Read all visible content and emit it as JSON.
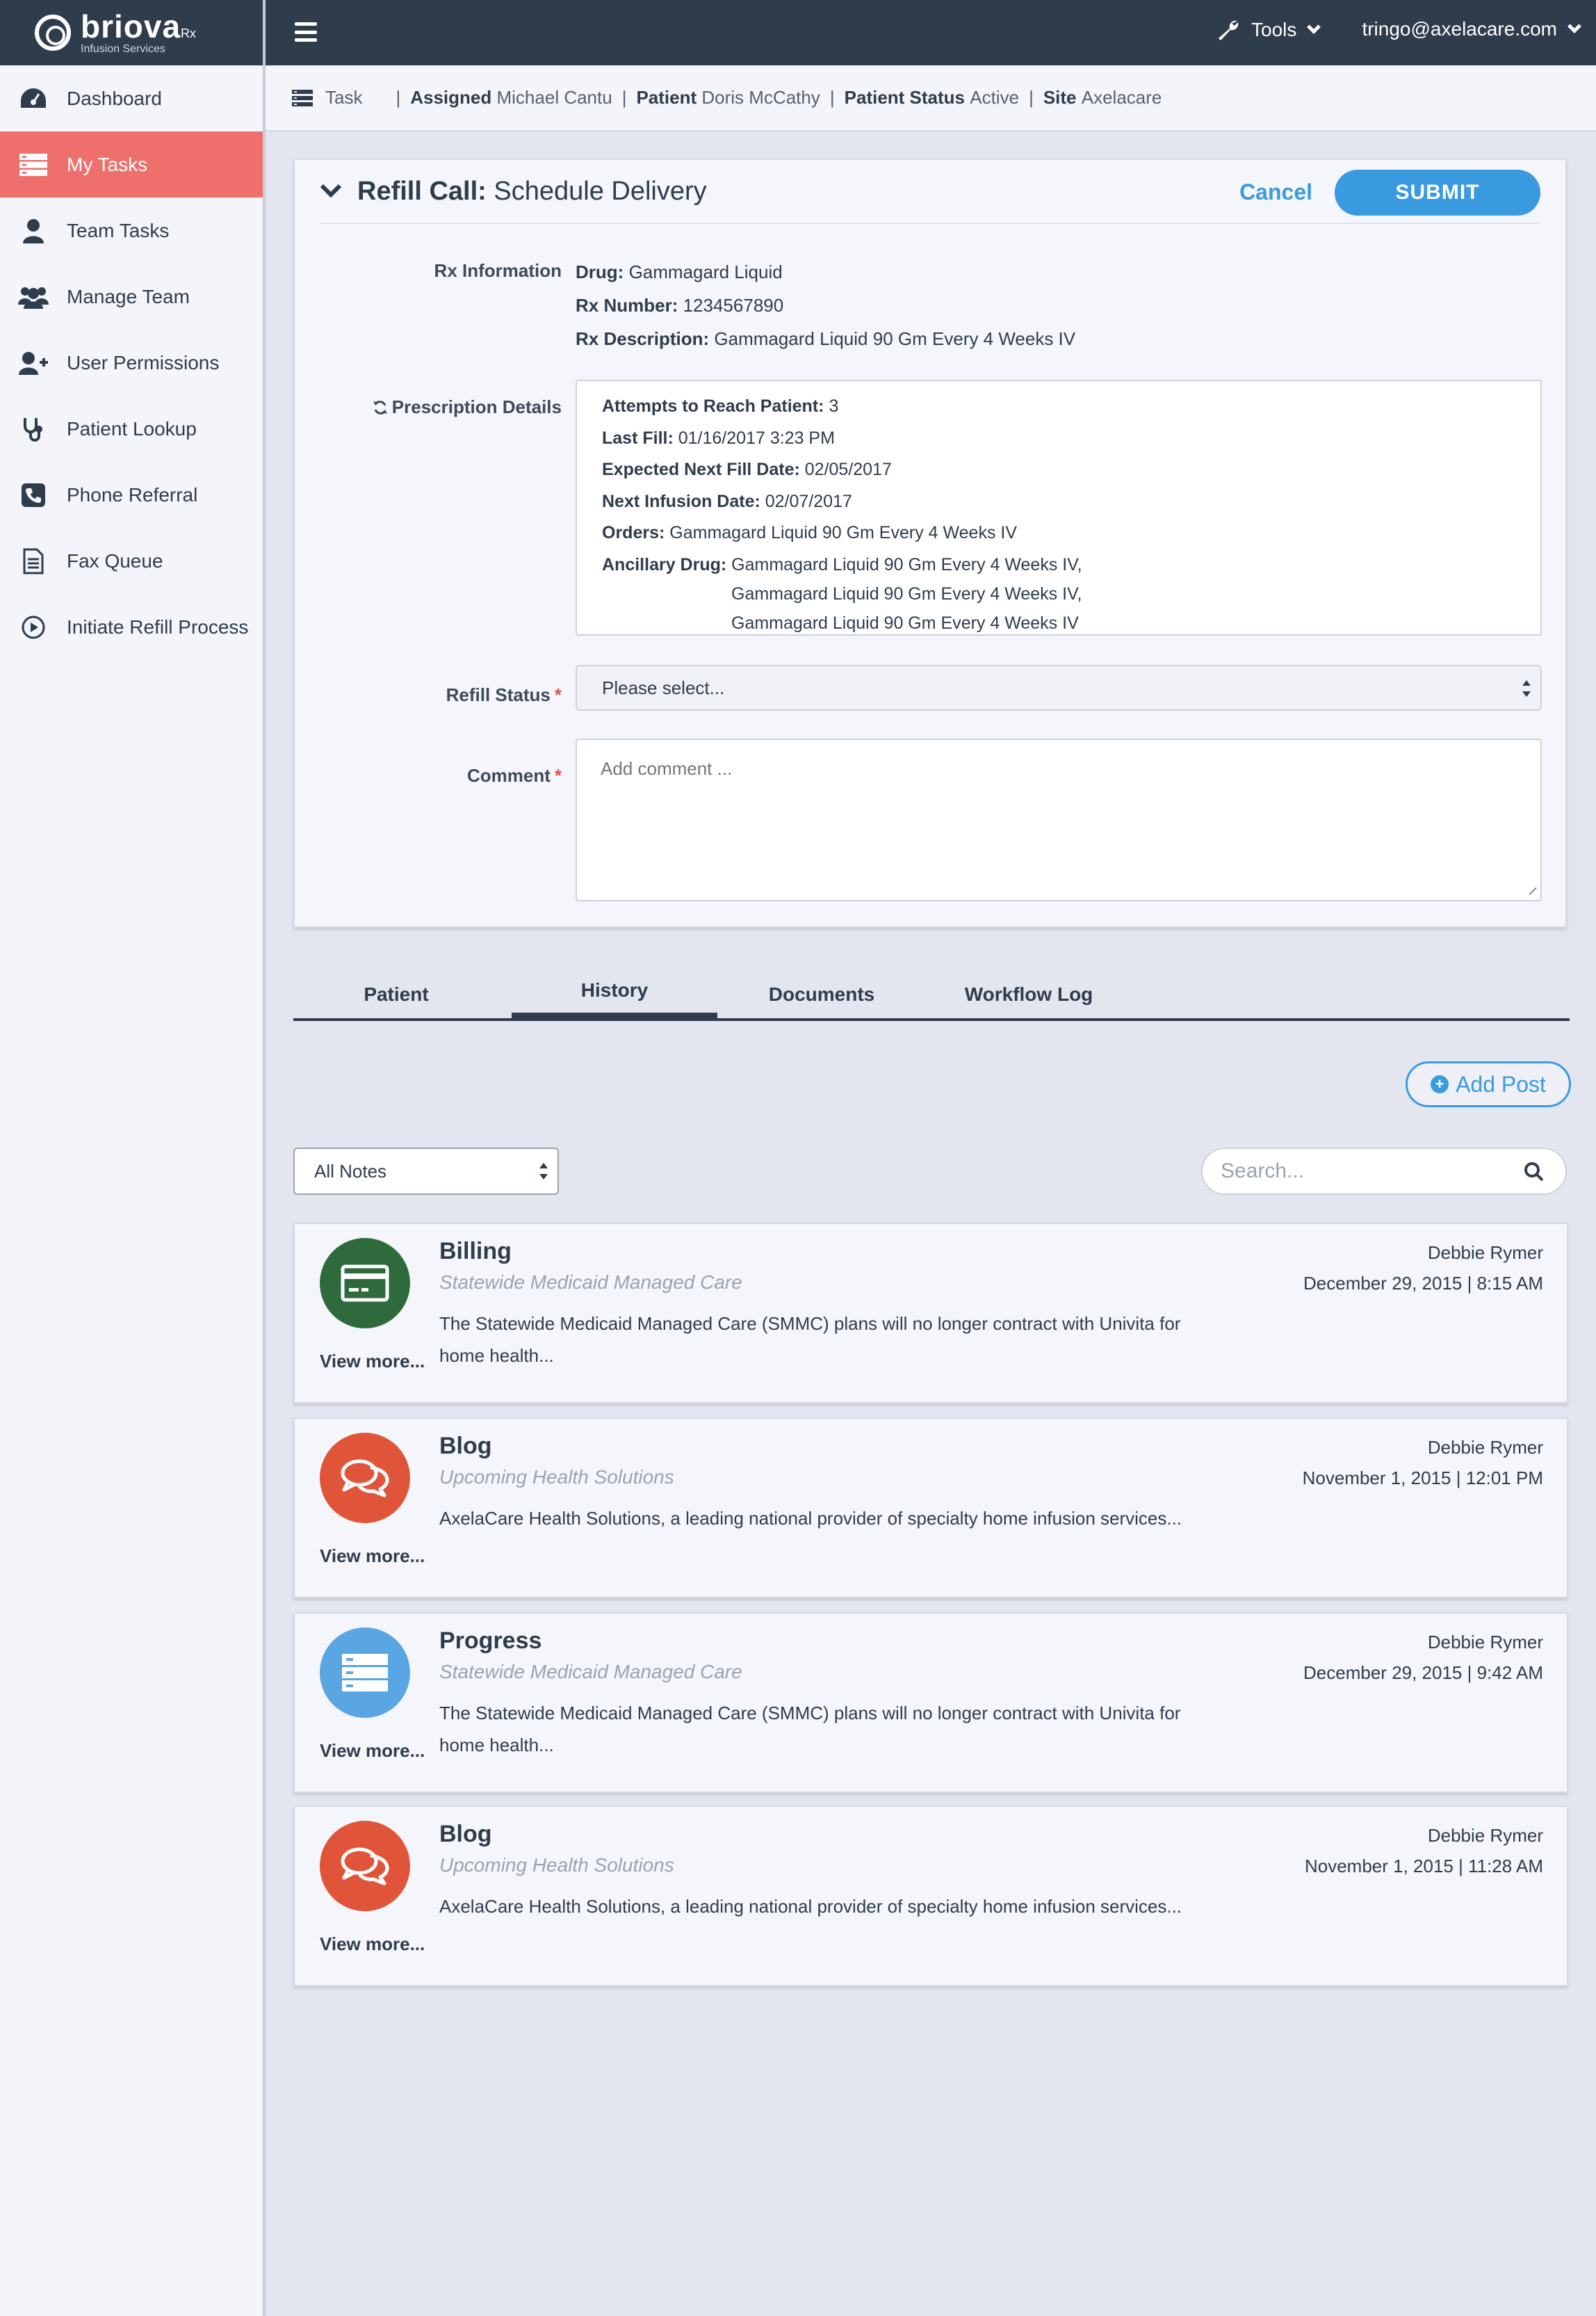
{
  "brand": {
    "name": "briova",
    "suffix": "Rx",
    "tagline": "Infusion Services"
  },
  "sidebar": {
    "items": [
      {
        "label": "Dashboard",
        "icon": "dashboard-icon"
      },
      {
        "label": "My Tasks",
        "icon": "tasks-icon",
        "active": true
      },
      {
        "label": "Team Tasks",
        "icon": "user-icon"
      },
      {
        "label": "Manage Team",
        "icon": "users-icon"
      },
      {
        "label": "User Permissions",
        "icon": "user-plus-icon"
      },
      {
        "label": "Patient Lookup",
        "icon": "stethoscope-icon"
      },
      {
        "label": "Phone Referral",
        "icon": "phone-icon"
      },
      {
        "label": "Fax Queue",
        "icon": "document-icon"
      },
      {
        "label": "Initiate Refill Process",
        "icon": "play-circle-icon"
      }
    ]
  },
  "topbar": {
    "tools_label": "Tools",
    "user_email": "tringo@axelacare.com"
  },
  "breadcrumb": {
    "task_label": "Task",
    "assigned_key": "Assigned",
    "assigned_val": "Michael Cantu",
    "patient_key": "Patient",
    "patient_val": "Doris McCathy",
    "status_key": "Patient Status",
    "status_val": "Active",
    "site_key": "Site",
    "site_val": "Axelacare"
  },
  "task": {
    "title_bold": "Refill Call:",
    "title_rest": "Schedule Delivery",
    "cancel_label": "Cancel",
    "submit_label": "SUBMIT",
    "rx_info_label": "Rx Information",
    "drug_key": "Drug:",
    "drug_val": "Gammagard Liquid",
    "rxnum_key": "Rx Number:",
    "rxnum_val": "1234567890",
    "rxdesc_key": "Rx Description:",
    "rxdesc_val": "Gammagard Liquid 90 Gm Every 4 Weeks IV",
    "presc_label": "Prescription Details",
    "attempts_key": "Attempts to Reach Patient:",
    "attempts_val": "3",
    "lastfill_key": "Last Fill:",
    "lastfill_val": "01/16/2017 3:23 PM",
    "nextfill_key": "Expected Next Fill Date:",
    "nextfill_val": "02/05/2017",
    "infusion_key": "Next Infusion Date:",
    "infusion_val": "02/07/2017",
    "orders_key": "Orders:",
    "orders_val": "Gammagard Liquid 90 Gm Every 4 Weeks IV",
    "ancillary_key": "Ancillary Drug:",
    "ancillary_vals": [
      "Gammagard Liquid 90 Gm Every 4 Weeks IV,",
      "Gammagard Liquid 90 Gm Every 4 Weeks IV,",
      "Gammagard Liquid 90 Gm Every 4 Weeks IV"
    ],
    "refill_status_label": "Refill Status",
    "refill_status_value": "Please select...",
    "comment_label": "Comment",
    "comment_placeholder": "Add comment ..."
  },
  "tabs": [
    "Patient",
    "History",
    "Documents",
    "Workflow Log"
  ],
  "history": {
    "add_post_label": "Add Post",
    "filter_value": "All Notes",
    "search_placeholder": "Search...",
    "posts": [
      {
        "title": "Billing",
        "subtitle": "Statewide Medicaid Managed Care",
        "body": "The Statewide Medicaid Managed Care (SMMC) plans will no longer contract with Univita for home health...",
        "author": "Debbie Rymer",
        "date": "December 29, 2015 | 8:15 AM",
        "view_more": "View more...",
        "icon": "credit-card-icon",
        "color": "#2e6a3b"
      },
      {
        "title": "Blog",
        "subtitle": "Upcoming Health Solutions",
        "body": "AxelaCare Health Solutions, a leading national provider of specialty home infusion services...",
        "author": "Debbie Rymer",
        "date": "November 1, 2015 | 12:01 PM",
        "view_more": "View more...",
        "icon": "chat-icon",
        "color": "#e0553a"
      },
      {
        "title": "Progress",
        "subtitle": "Statewide Medicaid Managed Care",
        "body": "The Statewide Medicaid Managed Care (SMMC) plans will no longer contract with Univita for home health...",
        "author": "Debbie Rymer",
        "date": "December 29, 2015 | 9:42 AM",
        "view_more": "View more...",
        "icon": "server-icon",
        "color": "#5aa6e2"
      },
      {
        "title": "Blog",
        "subtitle": "Upcoming Health Solutions",
        "body": "AxelaCare Health Solutions, a leading national provider of specialty home infusion services...",
        "author": "Debbie Rymer",
        "date": "November 1, 2015 | 11:28 AM",
        "view_more": "View more...",
        "icon": "chat-icon",
        "color": "#e0553a"
      }
    ]
  },
  "colors": {
    "navy": "#2f3c4c",
    "accent": "#3a9ae0",
    "active_nav": "#ef6f6c",
    "required": "#e0504a"
  }
}
